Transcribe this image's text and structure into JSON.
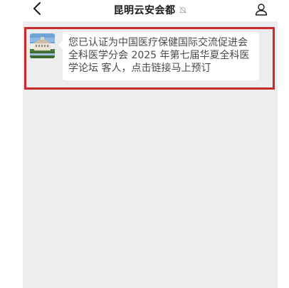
{
  "header": {
    "title": "昆明云安会都",
    "back_icon": "chevron-left-icon",
    "mute_icon": "bell-off-icon",
    "profile_icon": "person-icon"
  },
  "chat": {
    "messages": [
      {
        "sender_avatar": "hotel-building-photo",
        "text": "您已认证为中国医疗保健国际交流促进会全科医学分会 2025 年第七届华夏全科医学论坛 客人，点击链接马上预订"
      }
    ]
  },
  "colors": {
    "chat_background": "#ededed",
    "bubble_background": "#ffffff",
    "highlight_border": "#c62a2a",
    "text": "#4a4a4a"
  }
}
